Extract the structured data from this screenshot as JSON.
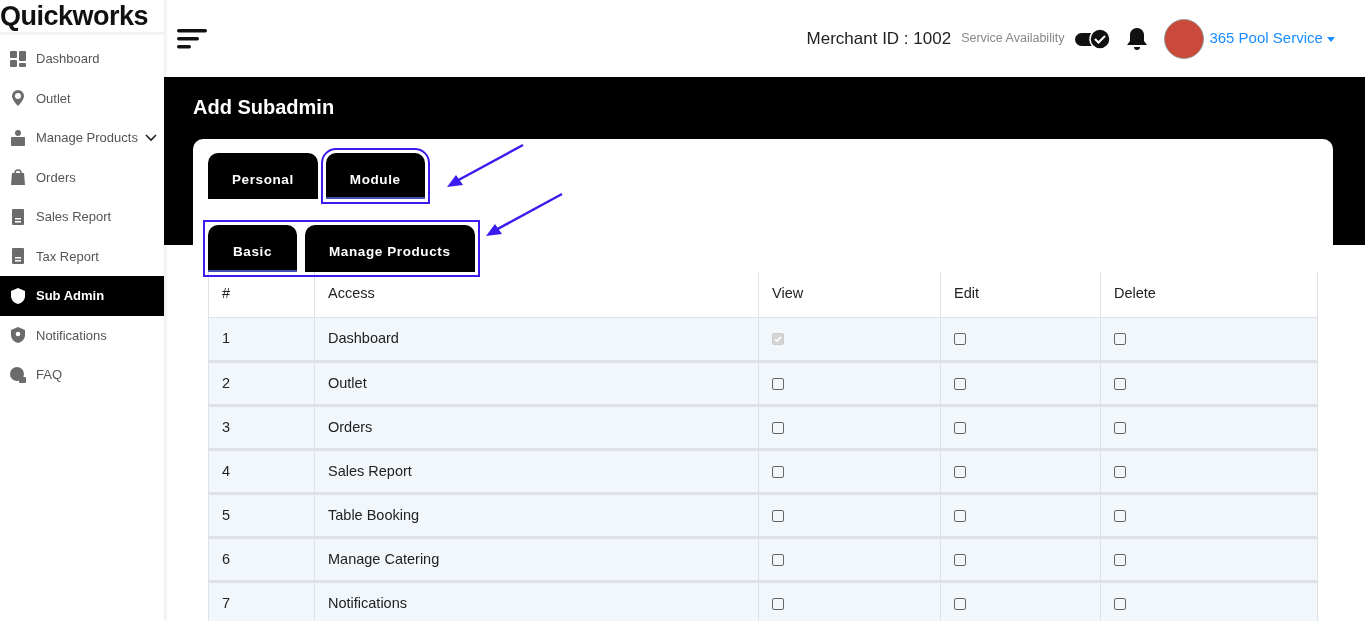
{
  "brand": "Quickworks",
  "sidebar": {
    "items": [
      {
        "label": "Dashboard",
        "selected": false
      },
      {
        "label": "Outlet",
        "selected": false
      },
      {
        "label": "Manage Products",
        "selected": false,
        "expandable": true
      },
      {
        "label": "Orders",
        "selected": false
      },
      {
        "label": "Sales Report",
        "selected": false
      },
      {
        "label": "Tax Report",
        "selected": false
      },
      {
        "label": "Sub Admin",
        "selected": true
      },
      {
        "label": "Notifications",
        "selected": false
      },
      {
        "label": "FAQ",
        "selected": false
      }
    ]
  },
  "header": {
    "merchant": "Merchant ID : 1002",
    "service_label": "Service Availability",
    "service_on": true,
    "user": "365 Pool Service"
  },
  "page_title": "Add Subadmin",
  "tabs": {
    "highlighted": true,
    "items": [
      {
        "label": "Personal",
        "selected": false
      },
      {
        "label": "Module",
        "selected": true
      }
    ]
  },
  "subtabs": {
    "highlighted": true,
    "items": [
      {
        "label": "Basic",
        "selected": true
      },
      {
        "label": "Manage Products",
        "selected": false
      }
    ]
  },
  "table": {
    "columns": [
      "#",
      "Access",
      "View",
      "Edit",
      "Delete"
    ],
    "rows": [
      {
        "num": "1",
        "access": "Dashboard",
        "perms": [
          {
            "checked": true,
            "disabled": true
          },
          {
            "checked": false,
            "disabled": false
          },
          {
            "checked": false,
            "disabled": false
          }
        ]
      },
      {
        "num": "2",
        "access": "Outlet",
        "perms": [
          {
            "checked": false,
            "disabled": false
          },
          {
            "checked": false,
            "disabled": false
          },
          {
            "checked": false,
            "disabled": false
          }
        ]
      },
      {
        "num": "3",
        "access": "Orders",
        "perms": [
          {
            "checked": false,
            "disabled": false
          },
          {
            "checked": false,
            "disabled": false
          },
          {
            "checked": false,
            "disabled": false
          }
        ]
      },
      {
        "num": "4",
        "access": "Sales Report",
        "perms": [
          {
            "checked": false,
            "disabled": false
          },
          {
            "checked": false,
            "disabled": false
          },
          {
            "checked": false,
            "disabled": false
          }
        ]
      },
      {
        "num": "5",
        "access": "Table Booking",
        "perms": [
          {
            "checked": false,
            "disabled": false
          },
          {
            "checked": false,
            "disabled": false
          },
          {
            "checked": false,
            "disabled": false
          }
        ]
      },
      {
        "num": "6",
        "access": "Manage Catering",
        "perms": [
          {
            "checked": false,
            "disabled": false
          },
          {
            "checked": false,
            "disabled": false
          },
          {
            "checked": false,
            "disabled": false
          }
        ]
      },
      {
        "num": "7",
        "access": "Notifications",
        "perms": [
          {
            "checked": false,
            "disabled": false
          },
          {
            "checked": false,
            "disabled": false
          },
          {
            "checked": false,
            "disabled": false
          }
        ]
      }
    ]
  }
}
